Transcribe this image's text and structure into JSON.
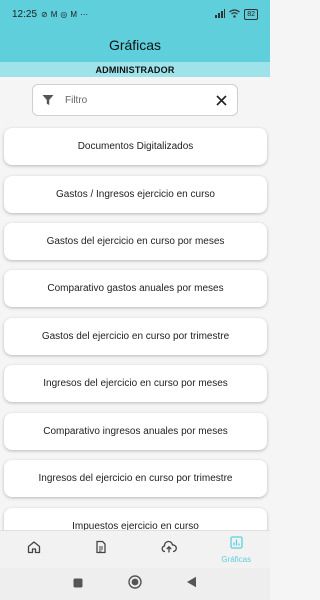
{
  "status_bar": {
    "time": "12:25",
    "notification_icons": [
      "sync-off-icon",
      "gmail-icon",
      "instagram-icon",
      "gmail-icon",
      "more-icon"
    ],
    "battery": "82"
  },
  "app_bar": {
    "title": "Gráficas"
  },
  "role_bar": {
    "label": "ADMINISTRADOR"
  },
  "filter": {
    "placeholder": "Filtro",
    "value": ""
  },
  "items": [
    {
      "label": "Documentos Digitalizados"
    },
    {
      "label": "Gastos / Ingresos ejercicio en curso"
    },
    {
      "label": "Gastos del ejercicio en curso por meses"
    },
    {
      "label": "Comparativo gastos anuales por meses"
    },
    {
      "label": "Gastos del ejercicio en curso por trimestre"
    },
    {
      "label": "Ingresos del ejercicio en curso por meses"
    },
    {
      "label": "Comparativo ingresos anuales por meses"
    },
    {
      "label": "Ingresos del ejercicio en curso por trimestre"
    },
    {
      "label": "Impuestos ejercicio en curso"
    }
  ],
  "bottom_nav": {
    "items": [
      {
        "icon": "home-icon",
        "label": ""
      },
      {
        "icon": "document-icon",
        "label": ""
      },
      {
        "icon": "cloud-upload-icon",
        "label": ""
      },
      {
        "icon": "chart-icon",
        "label": "Gráficas",
        "active": true
      }
    ]
  },
  "colors": {
    "primary": "#5fcfdc",
    "role_bar": "#9ee3ea",
    "active_tab": "#5fcfdc"
  }
}
